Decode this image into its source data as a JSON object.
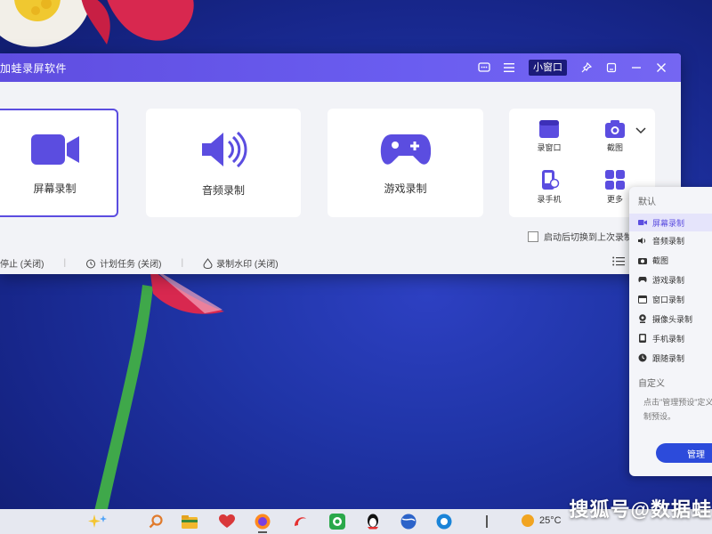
{
  "app": {
    "title": "加蛙录屏软件",
    "mini_window_label": "小窗口"
  },
  "cards": {
    "screen": {
      "label": "屏幕录制"
    },
    "audio": {
      "label": "音频录制"
    },
    "game": {
      "label": "游戏录制"
    },
    "more": {
      "items": [
        {
          "label": "录窗口"
        },
        {
          "label": "截图"
        },
        {
          "label": "录手机"
        },
        {
          "label": "更多"
        }
      ]
    }
  },
  "autostart": {
    "label": "启动后切换到上次录制"
  },
  "status": {
    "stop_label": "停止 (关闭)",
    "schedule_label": "计划任务 (关闭)",
    "watermark_label": "录制水印 (关闭)"
  },
  "preset_panel": {
    "default_section": "默认",
    "items": [
      {
        "label": "屏幕录制",
        "icon": "camera-icon",
        "active": true
      },
      {
        "label": "音频录制",
        "icon": "speaker-icon",
        "active": false
      },
      {
        "label": "截图",
        "icon": "photo-icon",
        "active": false
      },
      {
        "label": "游戏录制",
        "icon": "gamepad-icon",
        "active": false
      },
      {
        "label": "窗口录制",
        "icon": "window-icon",
        "active": false
      },
      {
        "label": "摄像头录制",
        "icon": "webcam-icon",
        "active": false
      },
      {
        "label": "手机录制",
        "icon": "phone-icon",
        "active": false
      },
      {
        "label": "跟随录制",
        "icon": "follow-icon",
        "active": false
      }
    ],
    "custom_section": "自定义",
    "hint": "点击\"管理预设\"定义录制预设。",
    "manage_label": "管理"
  },
  "taskbar": {
    "weather_temp": "25°C"
  },
  "watermark": "搜狐号@数据蛙",
  "colors": {
    "accent": "#5b4de0",
    "title_bar": "#6a5df0",
    "manage_button": "#2c4bdb",
    "desktop": "#1f2f9a"
  }
}
